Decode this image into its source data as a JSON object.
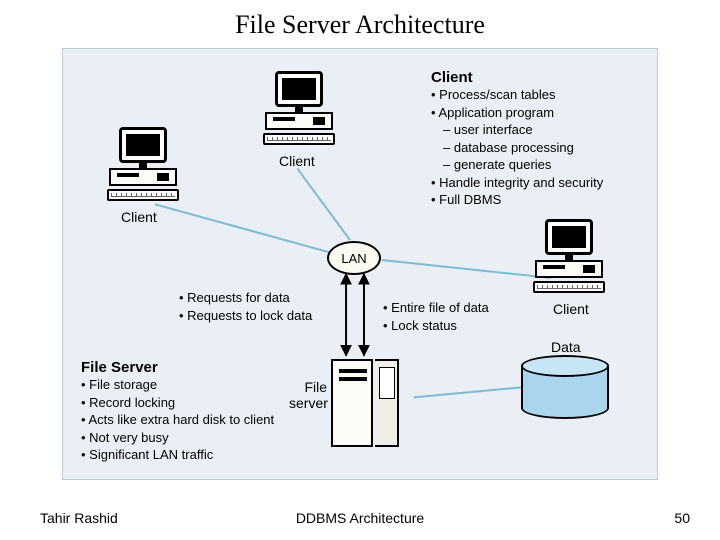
{
  "title": "File Server Architecture",
  "footer": {
    "author": "Tahir Rashid",
    "center": "DDBMS Architecture",
    "page": "50"
  },
  "labels": {
    "lan": "LAN",
    "client1": "Client",
    "client2": "Client",
    "client3": "Client",
    "server_caption": "File\nserver",
    "data": "Data"
  },
  "client_box": {
    "heading": "Client",
    "items": [
      {
        "cls": "bullet",
        "text": "Process/scan tables"
      },
      {
        "cls": "bullet",
        "text": "Application program"
      },
      {
        "cls": "sub",
        "text": "user interface"
      },
      {
        "cls": "sub",
        "text": "database processing"
      },
      {
        "cls": "sub",
        "text": "generate queries"
      },
      {
        "cls": "bullet",
        "text": "Handle integrity and security"
      },
      {
        "cls": "bullet",
        "text": "Full DBMS"
      }
    ]
  },
  "req_box": {
    "items": [
      {
        "cls": "bullet",
        "text": "Requests for data"
      },
      {
        "cls": "bullet",
        "text": "Requests to lock data"
      }
    ]
  },
  "resp_box": {
    "items": [
      {
        "cls": "bullet",
        "text": "Entire file of data"
      },
      {
        "cls": "bullet",
        "text": "Lock status"
      }
    ]
  },
  "fs_box": {
    "heading": "File Server",
    "items": [
      {
        "cls": "bullet",
        "text": "File storage"
      },
      {
        "cls": "bullet",
        "text": "Record locking"
      },
      {
        "cls": "bullet",
        "text": "Acts like extra hard disk to client"
      },
      {
        "cls": "bullet",
        "text": "Not very busy"
      },
      {
        "cls": "bullet",
        "text": "Significant LAN traffic"
      }
    ]
  }
}
